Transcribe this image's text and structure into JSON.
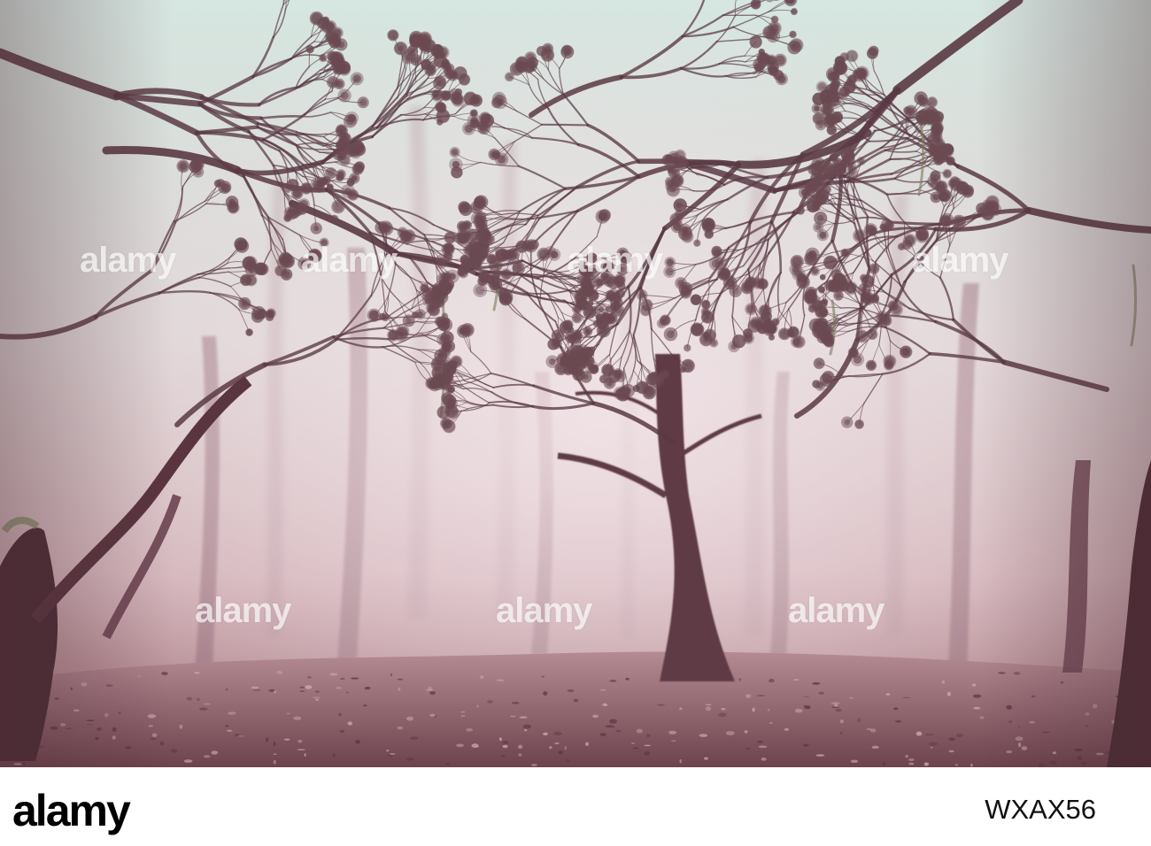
{
  "photo": {
    "subject": "misty forest with moss-covered trees",
    "palette": {
      "fog_light": "#e8dede",
      "fog_mid": "#c9a9b0",
      "sky_teal": "#cfe3dd",
      "branch_dark": "#5a3a44",
      "trunk": "#6b4550",
      "ground": "#7a4f58"
    }
  },
  "watermark": {
    "text": "alamy"
  },
  "footer": {
    "brand": "alamy",
    "image_id": "WXAX56"
  }
}
